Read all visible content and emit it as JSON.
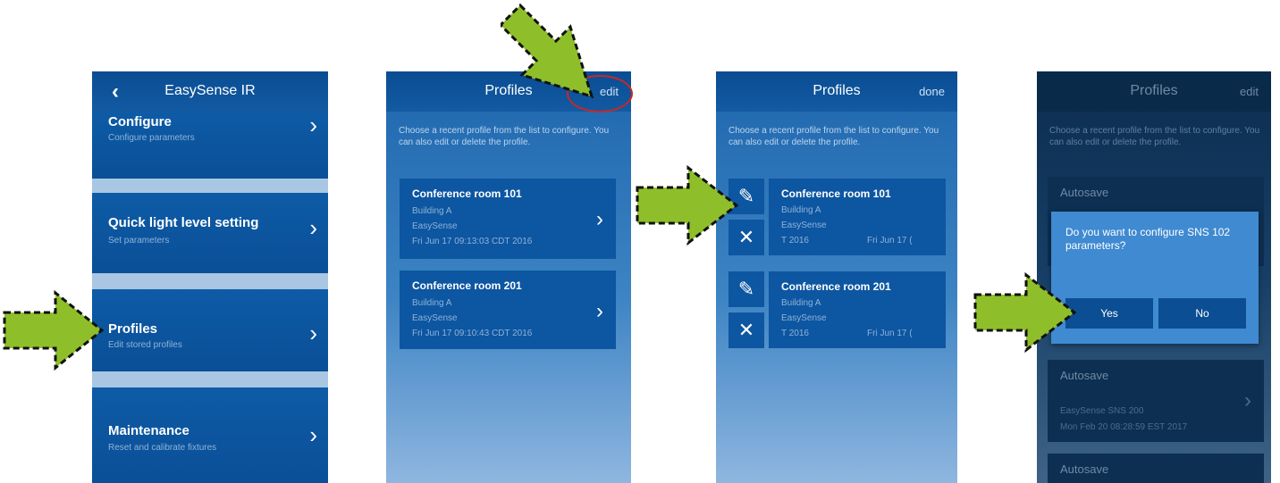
{
  "screen1": {
    "title": "EasySense IR",
    "items": [
      {
        "title": "Configure",
        "subtitle": "Configure parameters"
      },
      {
        "title": "Quick light level setting",
        "subtitle": "Set parameters"
      },
      {
        "title": "Profiles",
        "subtitle": "Edit stored profiles"
      },
      {
        "title": "Maintenance",
        "subtitle": "Reset and calibrate fixtures"
      }
    ],
    "chevron": "›"
  },
  "screen2": {
    "title": "Profiles",
    "action": "edit",
    "description": "Choose a recent profile from the list to configure. You can also edit or delete the profile.",
    "profiles": [
      {
        "name": "Conference room 101",
        "building": "Building A",
        "type": "EasySense",
        "date": "Fri Jun 17 09:13:03 CDT 2016"
      },
      {
        "name": "Conference room 201",
        "building": "Building A",
        "type": "EasySense",
        "date": "Fri Jun 17 09:10:43 CDT 2016"
      }
    ]
  },
  "screen3": {
    "title": "Profiles",
    "action": "done",
    "description": "Choose a recent profile from the list to configure. You can also edit or delete the profile.",
    "profiles": [
      {
        "name": "Conference room 101",
        "building": "Building A",
        "type": "EasySense",
        "date_left": "T 2016",
        "date_right": "Fri Jun 17 ("
      },
      {
        "name": "Conference room 201",
        "building": "Building A",
        "type": "EasySense",
        "date_left": "T 2016",
        "date_right": "Fri Jun 17 ("
      }
    ],
    "edit_icon": "✎",
    "delete_icon": "✕"
  },
  "screen4": {
    "title": "Profiles",
    "action": "edit",
    "description": "Choose a recent profile from the list to configure. You can also edit or delete the profile.",
    "cards": [
      {
        "name": "Autosave"
      },
      {
        "name": "Autosave",
        "line1": "EasySense SNS 200",
        "line2": "Mon Feb 20 08:28:59 EST 2017"
      },
      {
        "name": "Autosave"
      }
    ],
    "dialog": {
      "question": "Do you want to configure SNS 102 parameters?",
      "yes": "Yes",
      "no": "No"
    }
  },
  "colors": {
    "arrow": "#8ebf2a",
    "accent": "#0d56a1",
    "highlight": "#c62828"
  }
}
